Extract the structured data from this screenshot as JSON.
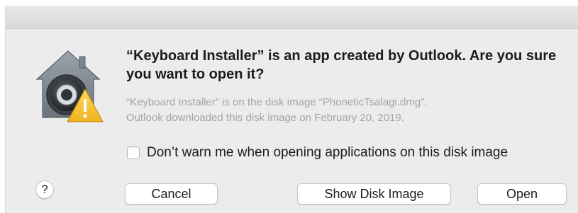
{
  "dialog": {
    "title": "“Keyboard Installer” is an app created by Outlook. Are you sure you want to open it?",
    "info_line1": "“Keyboard Installer” is on the disk image “PhoneticTsalagi.dmg”.",
    "info_line2": "Outlook downloaded this disk image on February 20, 2019.",
    "checkbox": {
      "label": "Don’t warn me when opening applications on this disk image",
      "checked": false
    },
    "icon": "gatekeeper-warning-icon",
    "help_label": "?",
    "buttons": {
      "cancel": "Cancel",
      "show_disk_image": "Show Disk Image",
      "open": "Open"
    }
  },
  "colors": {
    "window_bg": "#ececec",
    "title_text": "#1c1c1c",
    "info_text": "#a4a4a4",
    "warning_yellow": "#f6c23a"
  }
}
